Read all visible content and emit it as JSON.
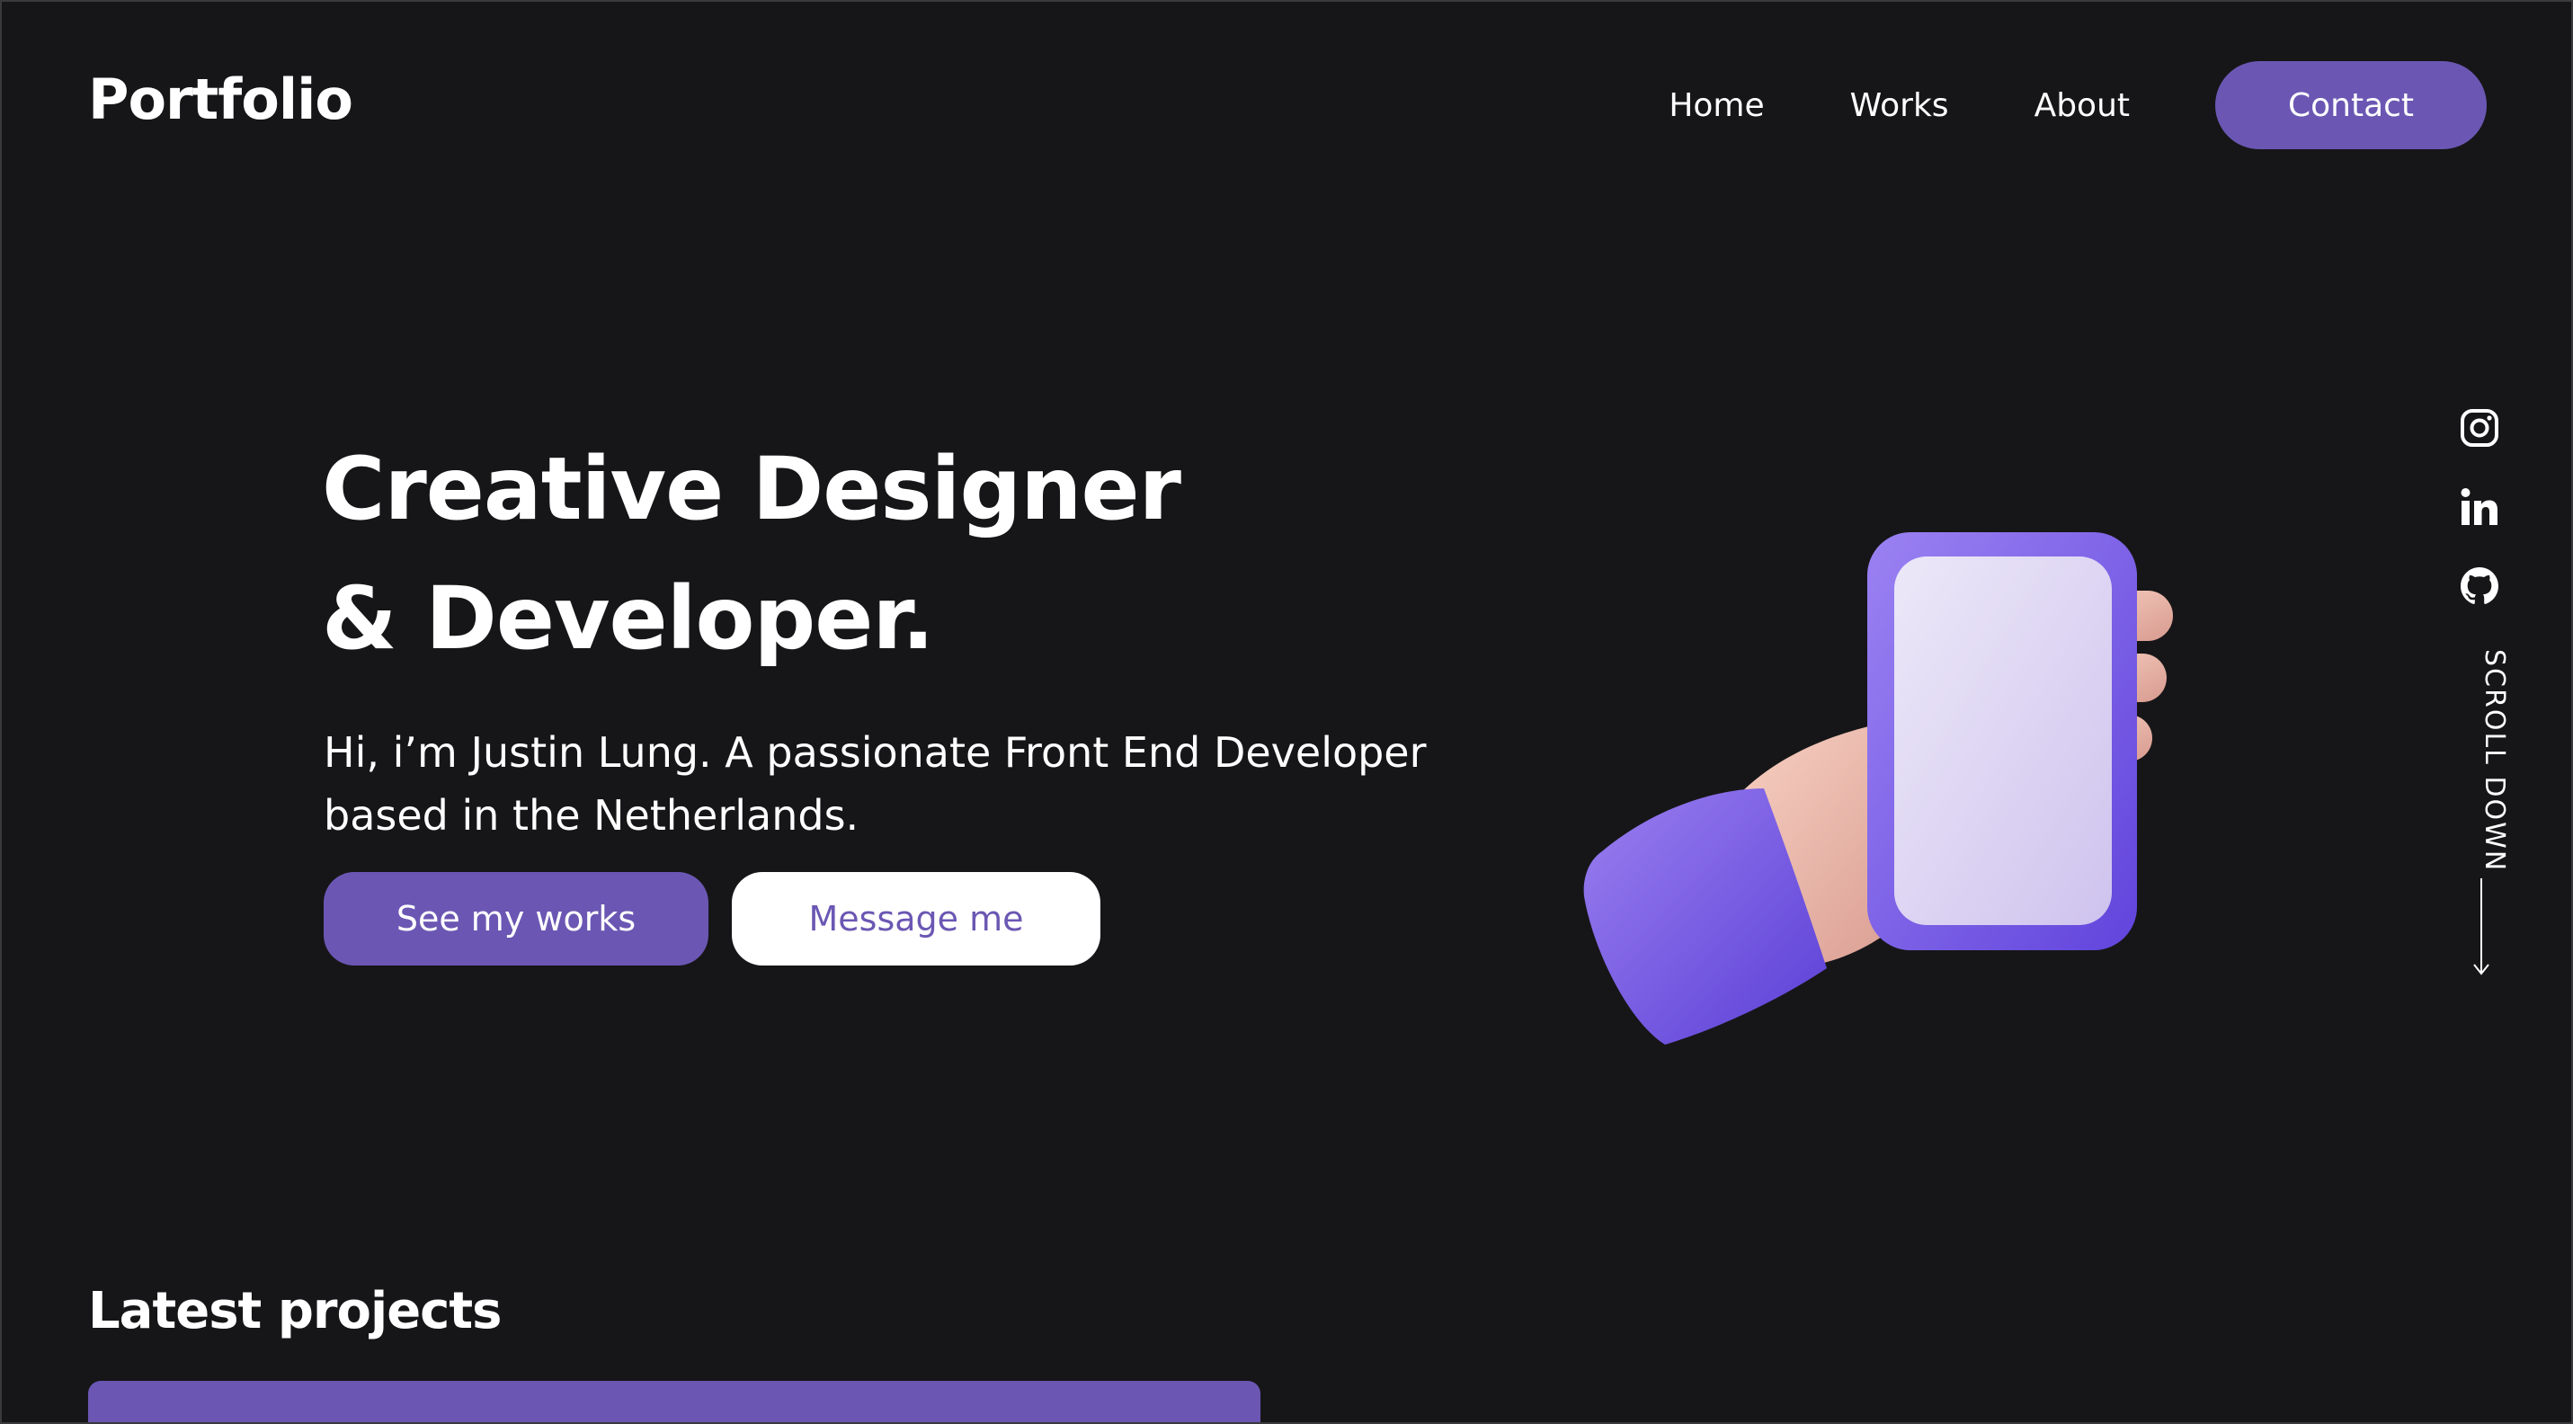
{
  "header": {
    "logo": "Portfolio",
    "nav": [
      {
        "label": "Home"
      },
      {
        "label": "Works"
      },
      {
        "label": "About"
      }
    ],
    "contact_label": "Contact"
  },
  "hero": {
    "title_line1": "Creative Designer",
    "title_line2": "& Developer.",
    "text_line1": "Hi, i’m Justin Lung. A passionate Front End Developer",
    "text_line2": "based in the Netherlands.",
    "primary_button": "See my works",
    "secondary_button": "Message me",
    "illustration": "hand-holding-phone"
  },
  "social": {
    "icons": [
      "instagram-icon",
      "linkedin-icon",
      "github-icon"
    ],
    "scroll_label": "SCROLL DOWN"
  },
  "projects": {
    "title": "Latest projects"
  },
  "colors": {
    "background": "#161618",
    "accent": "#6b57b3",
    "text": "#ffffff"
  }
}
